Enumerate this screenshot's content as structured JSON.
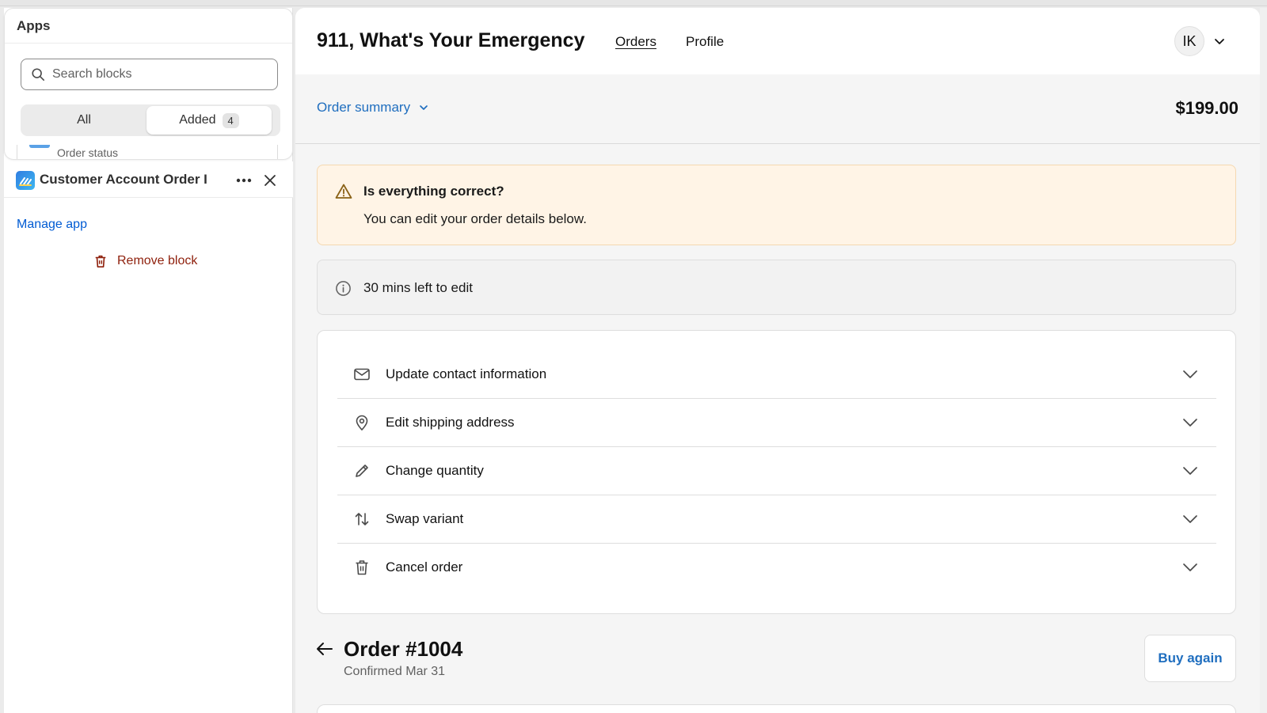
{
  "apps_panel": {
    "title": "Apps",
    "search_placeholder": "Search blocks",
    "segments": {
      "all": "All",
      "added": "Added",
      "added_count": "4"
    },
    "peek_item": "Order status"
  },
  "block": {
    "title": "Customer Account Order I",
    "manage_app": "Manage app",
    "remove_block": "Remove block"
  },
  "storefront": {
    "shop_title": "911, What's Your Emergency",
    "nav": {
      "orders": "Orders",
      "profile": "Profile"
    },
    "avatar_initials": "IK",
    "order_summary_label": "Order summary",
    "order_total": "$199.00",
    "banner": {
      "title": "Is everything correct?",
      "text": "You can edit your order details below."
    },
    "edit_notice": "30 mins left to edit",
    "actions": [
      {
        "label": "Update contact information",
        "icon": "mail-icon"
      },
      {
        "label": "Edit shipping address",
        "icon": "location-icon"
      },
      {
        "label": "Change quantity",
        "icon": "pencil-icon"
      },
      {
        "label": "Swap variant",
        "icon": "swap-icon"
      },
      {
        "label": "Cancel order",
        "icon": "trash-icon"
      }
    ],
    "order": {
      "title": "Order #1004",
      "subtitle": "Confirmed Mar 31",
      "buy_again": "Buy again"
    }
  },
  "colors": {
    "link_blue": "#1f6ebf",
    "admin_blue": "#005bd3",
    "critical": "#8e1f0b",
    "warning_bg": "#fff4e6"
  }
}
